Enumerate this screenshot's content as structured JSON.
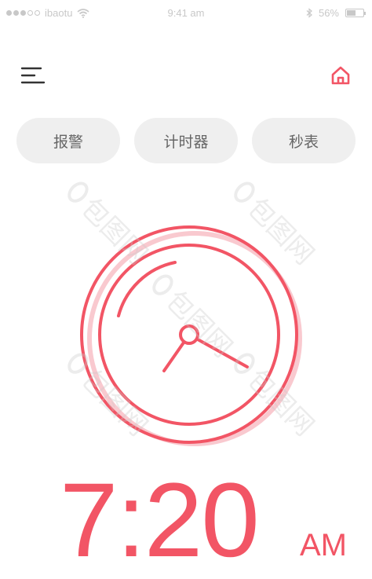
{
  "status_bar": {
    "carrier": "ibaotu",
    "time": "9:41 am",
    "battery_percent": "56%",
    "battery_level": 0.56,
    "signal_icon": "signal-dots-icon",
    "wifi_icon": "wifi-icon",
    "bluetooth_icon": "bluetooth-icon"
  },
  "header": {
    "menu_icon": "menu-icon",
    "home_icon": "home-icon"
  },
  "tabs": [
    {
      "label": "报警"
    },
    {
      "label": "计时器"
    },
    {
      "label": "秒表"
    }
  ],
  "clock": {
    "icon": "analog-clock-icon",
    "hour": 7,
    "minute": 20
  },
  "time_display": {
    "value": "7:20",
    "period": "AM"
  },
  "colors": {
    "accent": "#f25565",
    "tab_background": "#efefef",
    "tab_text": "#666666",
    "status_text": "#c8c8c8"
  },
  "watermark": {
    "text": "包图网"
  }
}
